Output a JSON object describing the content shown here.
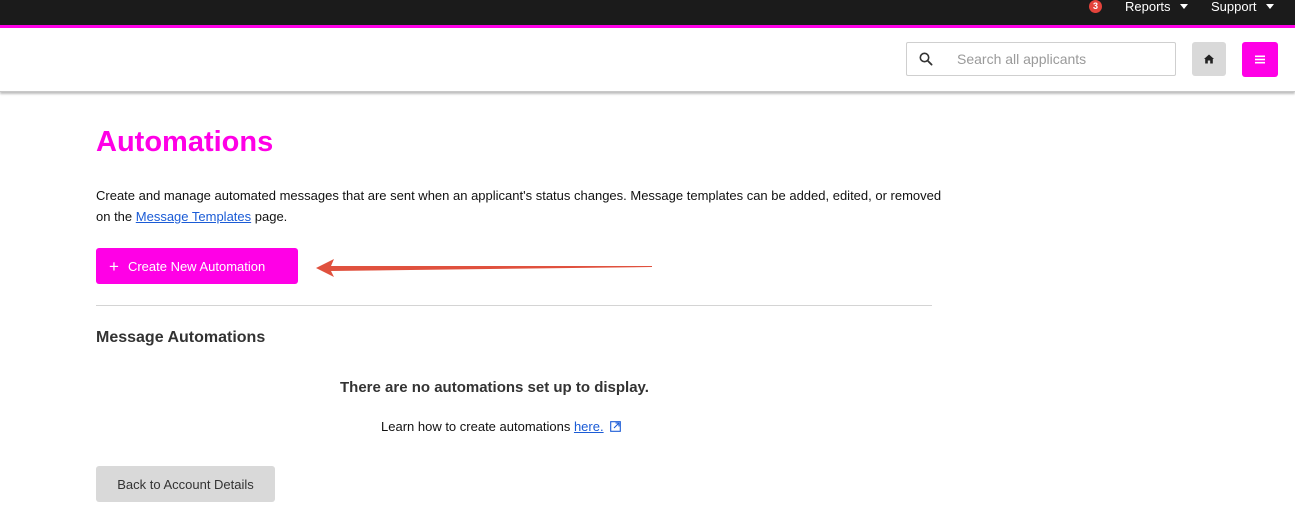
{
  "topbar": {
    "badge_count": "3",
    "reports_label": "Reports",
    "support_label": "Support"
  },
  "header": {
    "search": {
      "placeholder": "Search all applicants",
      "value": ""
    },
    "home_icon": "home-icon",
    "menu_icon": "hamburger-menu-icon"
  },
  "main": {
    "title": "Automations",
    "description_before": "Create and manage automated messages that are sent when an applicant's status changes. Message templates can be added, edited, or removed on the ",
    "description_link": "Message Templates",
    "description_after": " page.",
    "create_button_plus": "+",
    "create_button_label": "Create New Automation",
    "section_title": "Message Automations",
    "empty_message": "There are no automations set up to display.",
    "learn_prefix": "Learn how to create automations ",
    "learn_link": "here.",
    "back_button_label": "Back to Account Details"
  },
  "colors": {
    "accent": "#ff00e6",
    "topbar": "#1b1b1b",
    "badge": "#e4433b",
    "link": "#1a5bd6",
    "annotation_arrow": "#e0513e"
  }
}
